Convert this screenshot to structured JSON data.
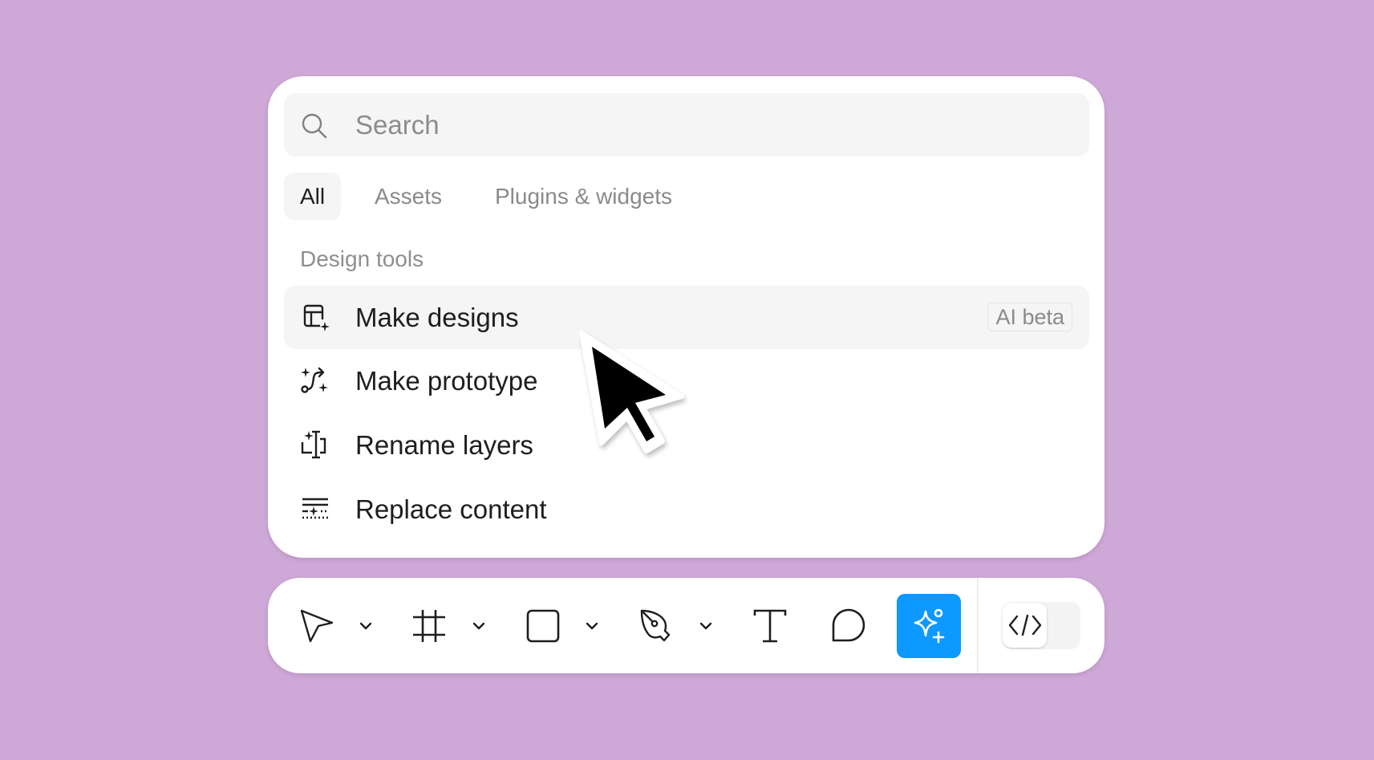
{
  "search": {
    "placeholder": "Search",
    "value": "",
    "icon": "search-icon"
  },
  "tabs": [
    {
      "label": "All",
      "active": true
    },
    {
      "label": "Assets",
      "active": false
    },
    {
      "label": "Plugins & widgets",
      "active": false
    }
  ],
  "section": {
    "label": "Design tools",
    "items": [
      {
        "label": "Make designs",
        "icon": "make-designs-icon",
        "badge": "AI beta",
        "highlighted": true
      },
      {
        "label": "Make prototype",
        "icon": "make-prototype-icon",
        "highlighted": false
      },
      {
        "label": "Rename layers",
        "icon": "rename-layers-icon",
        "highlighted": false
      },
      {
        "label": "Replace content",
        "icon": "replace-content-icon",
        "highlighted": false
      }
    ]
  },
  "toolbar": {
    "tools": [
      {
        "name": "move-tool",
        "icon": "move-arrow-icon",
        "has_menu": true
      },
      {
        "name": "frame-tool",
        "icon": "frame-hash-icon",
        "has_menu": true
      },
      {
        "name": "rectangle-tool",
        "icon": "rectangle-icon",
        "has_menu": true
      },
      {
        "name": "pen-tool",
        "icon": "pen-nib-icon",
        "has_menu": true
      },
      {
        "name": "text-tool",
        "icon": "text-t-icon",
        "has_menu": false
      },
      {
        "name": "comment-tool",
        "icon": "comment-bubble-icon",
        "has_menu": false
      },
      {
        "name": "ai-actions-tool",
        "icon": "ai-sparkle-icon",
        "active": true
      }
    ],
    "dev_mode_toggle": {
      "icon": "code-brackets-icon",
      "enabled": false
    }
  },
  "colors": {
    "background": "#CEA8D6",
    "accent": "#0D99FF",
    "highlight_row": "#F5F5F5",
    "text_primary": "#1E1E1E",
    "text_secondary": "#8A8A8A"
  }
}
